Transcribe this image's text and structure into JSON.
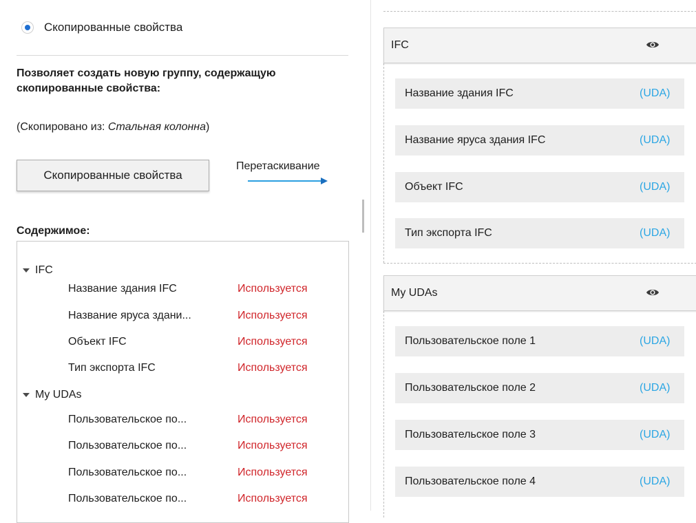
{
  "left_panel": {
    "radio_label": "Скопированные свойства",
    "description": "Позволяет создать новую группу, содержащую скопированные свойства:",
    "copied_from_prefix": "(Скопировано из: ",
    "copied_from_source": "Стальная колонна",
    "copied_from_suffix": ")",
    "copied_button": "Скопированные свойства",
    "drag_label": "Перетаскивание",
    "content_title": "Содержимое:",
    "tree": {
      "groups": [
        {
          "name": "IFC",
          "items": [
            {
              "name": "Название здания IFC",
              "status": "Используется"
            },
            {
              "name": "Название яруса здани...",
              "status": "Используется"
            },
            {
              "name": "Объект IFC",
              "status": "Используется"
            },
            {
              "name": "Тип экспорта IFC",
              "status": "Используется"
            }
          ]
        },
        {
          "name": "My UDAs",
          "items": [
            {
              "name": "Пользовательское по...",
              "status": "Используется"
            },
            {
              "name": "Пользовательское по...",
              "status": "Используется"
            },
            {
              "name": "Пользовательское по...",
              "status": "Используется"
            },
            {
              "name": "Пользовательское по...",
              "status": "Используется"
            }
          ]
        }
      ]
    }
  },
  "right_panel": {
    "groups": [
      {
        "title": "IFC",
        "properties": [
          {
            "name": "Название здания IFC",
            "tag": "(UDA)"
          },
          {
            "name": "Название яруса здания IFC",
            "tag": "(UDA)"
          },
          {
            "name": "Объект IFC",
            "tag": "(UDA)"
          },
          {
            "name": "Тип экспорта IFC",
            "tag": "(UDA)"
          }
        ]
      },
      {
        "title": "My UDAs",
        "properties": [
          {
            "name": "Пользовательское поле 1",
            "tag": "(UDA)"
          },
          {
            "name": "Пользовательское поле 2",
            "tag": "(UDA)"
          },
          {
            "name": "Пользовательское поле 3",
            "tag": "(UDA)"
          },
          {
            "name": "Пользовательское поле 4",
            "tag": "(UDA)"
          }
        ]
      }
    ]
  },
  "colors": {
    "accent_blue": "#1f6fd1",
    "status_red": "#d0252a",
    "uda_blue": "#2ba6e4"
  },
  "icons": {
    "radio": "radio-selected-icon",
    "arrow": "arrow-right-icon",
    "caret": "caret-down-icon",
    "eye": "eye-icon"
  }
}
